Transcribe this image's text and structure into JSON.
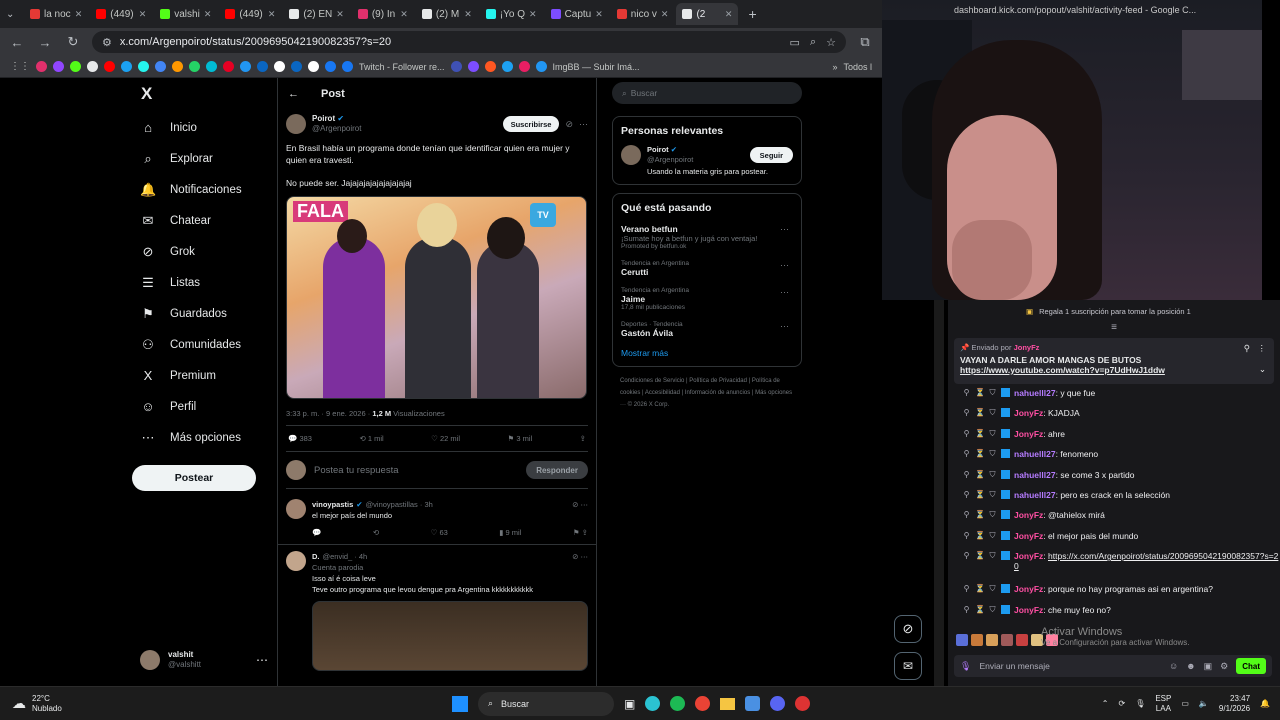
{
  "browser": {
    "tabs": [
      {
        "label": "la noc",
        "color": "#e53935"
      },
      {
        "label": "(449)",
        "color": "#ff0000"
      },
      {
        "label": "valshi",
        "color": "#53fc18"
      },
      {
        "label": "(449)",
        "color": "#ff0000"
      },
      {
        "label": "(2) EN",
        "color": "#e7e9ea"
      },
      {
        "label": "(9) In",
        "color": "#e1306c"
      },
      {
        "label": "(2) M",
        "color": "#e7e9ea"
      },
      {
        "label": "¡Yo Q",
        "color": "#25f4ee"
      },
      {
        "label": "Captu",
        "color": "#7c4dff"
      },
      {
        "label": "nico v",
        "color": "#e53935"
      },
      {
        "label": "(2",
        "color": "#e7e9ea",
        "active": true
      }
    ],
    "url": "x.com/Argenpoirot/status/2009695042190082357?s=20",
    "bookmarks": [
      "Twitch - Follower re...",
      "ImgBB — Subir Imá...",
      "Todos l"
    ]
  },
  "nav": {
    "logo": "X",
    "items": [
      {
        "label": "Inicio",
        "icon": "⌂"
      },
      {
        "label": "Explorar",
        "icon": "⌕"
      },
      {
        "label": "Notificaciones",
        "icon": "🔔"
      },
      {
        "label": "Chatear",
        "icon": "✉"
      },
      {
        "label": "Grok",
        "icon": "⊘"
      },
      {
        "label": "Listas",
        "icon": "☰"
      },
      {
        "label": "Guardados",
        "icon": "⚑"
      },
      {
        "label": "Comunidades",
        "icon": "⚇"
      },
      {
        "label": "Premium",
        "icon": "X"
      },
      {
        "label": "Perfil",
        "icon": "☺"
      },
      {
        "label": "Más opciones",
        "icon": "⋯"
      }
    ],
    "post_label": "Postear",
    "account_name": "valshit",
    "account_handle": "@valshitt"
  },
  "post": {
    "header": "Post",
    "author": "Poirot",
    "handle": "@Argenpoirot",
    "subscribe": "Suscribirse",
    "text1": "En Brasil había un programa donde tenían que identificar quien era mujer y quien era travesti.",
    "text2": "No puede ser. Jajajajajajajajajajaj",
    "media_logo": "FALA",
    "media_badge": "TV",
    "timestamp": "3:33 p. m. · 9 ene. 2026 · ",
    "views_count": "1,2 M",
    "views_label": "Visualizaciones",
    "replies": "383",
    "reposts": "1 mil",
    "likes": "22 mil",
    "bookmarks": "3 mil",
    "reply_placeholder": "Postea tu respuesta",
    "reply_btn": "Responder"
  },
  "replies": [
    {
      "name": "vinoypastis",
      "handle": "@vinoypastillas · 3h",
      "text": "el mejor país del mundo",
      "likes": "63",
      "views": "9 mil"
    },
    {
      "name": "D.",
      "handle": "@envid_ · 4h",
      "parody": "Cuenta parodia",
      "text": "Isso aí é coisa leve",
      "text2": "Teve outro programa que levou dengue pra Argentina kkkkkkkkkkk"
    }
  ],
  "right": {
    "search_placeholder": "Buscar",
    "relevant_title": "Personas relevantes",
    "rel_name": "Poirot",
    "rel_handle": "@Argenpoirot",
    "rel_bio": "Usando la materia gris para postear.",
    "follow": "Seguir",
    "happening_title": "Qué está pasando",
    "trends": [
      {
        "meta": "",
        "title": "Verano betfun",
        "desc": "¡Sumate hoy a betfun y jugá con ventaja!",
        "promo": "Promoted by betfun.ok"
      },
      {
        "meta": "Tendencia en Argentina",
        "title": "Cerutti"
      },
      {
        "meta": "Tendencia en Argentina",
        "title": "Jaime",
        "count": "17,8 mil publicaciones"
      },
      {
        "meta": "Deportes · Tendencia",
        "title": "Gastón Ávila"
      }
    ],
    "show_more": "Mostrar más",
    "footer": "Condiciones de Servicio | Política de Privacidad | Política de cookies | Accesibilidad | Información de anuncios | Más opciones ··· © 2026 X Corp."
  },
  "chat": {
    "popout_url": "dashboard.kick.com/popout/valshit/activity-feed - Google C...",
    "sub_banner": "Regala 1 suscripción para tomar la posición 1",
    "pinned_by": "Enviado por",
    "pinned_user": "JonyFz",
    "pinned_text": "VAYAN A DARLE AMOR MANGAS DE BUTOS",
    "pinned_link": "https://www.youtube.com/watch?v=p7UdHwJ1ddw",
    "messages": [
      {
        "user": "nahuelll27",
        "color": "#b57bff",
        "text": "y que fue"
      },
      {
        "user": "JonyFz",
        "color": "#ff4fa3",
        "text": "KJADJA"
      },
      {
        "user": "JonyFz",
        "color": "#ff4fa3",
        "text": "ahre"
      },
      {
        "user": "nahuelll27",
        "color": "#b57bff",
        "text": "fenomeno"
      },
      {
        "user": "nahuelll27",
        "color": "#b57bff",
        "text": "se come 3 x partido"
      },
      {
        "user": "nahuelll27",
        "color": "#b57bff",
        "text": "pero es crack en la selección"
      },
      {
        "user": "JonyFz",
        "color": "#ff4fa3",
        "text": "@tahielox mirá"
      },
      {
        "user": "JonyFz",
        "color": "#ff4fa3",
        "text": "el mejor pais del mundo"
      },
      {
        "user": "JonyFz",
        "color": "#ff4fa3",
        "text": "https://x.com/Argenpoirot/status/2009695042190082357?s=20",
        "link": true
      },
      {
        "user": "JonyFz",
        "color": "#ff4fa3",
        "text": "porque no hay programas asi en argentina?"
      },
      {
        "user": "JonyFz",
        "color": "#ff4fa3",
        "text": "che muy feo no?"
      }
    ],
    "input_placeholder": "Enviar un mensaje",
    "chat_btn": "Chat",
    "activate_windows": "Activar Windows",
    "activate_sub": "Ve a Configuración para activar Windows."
  },
  "taskbar": {
    "weather_temp": "22°C",
    "weather_desc": "Nublado",
    "search": "Buscar",
    "lang1": "ESP",
    "lang2": "LAA",
    "time": "23:47",
    "date": "9/1/2026"
  }
}
